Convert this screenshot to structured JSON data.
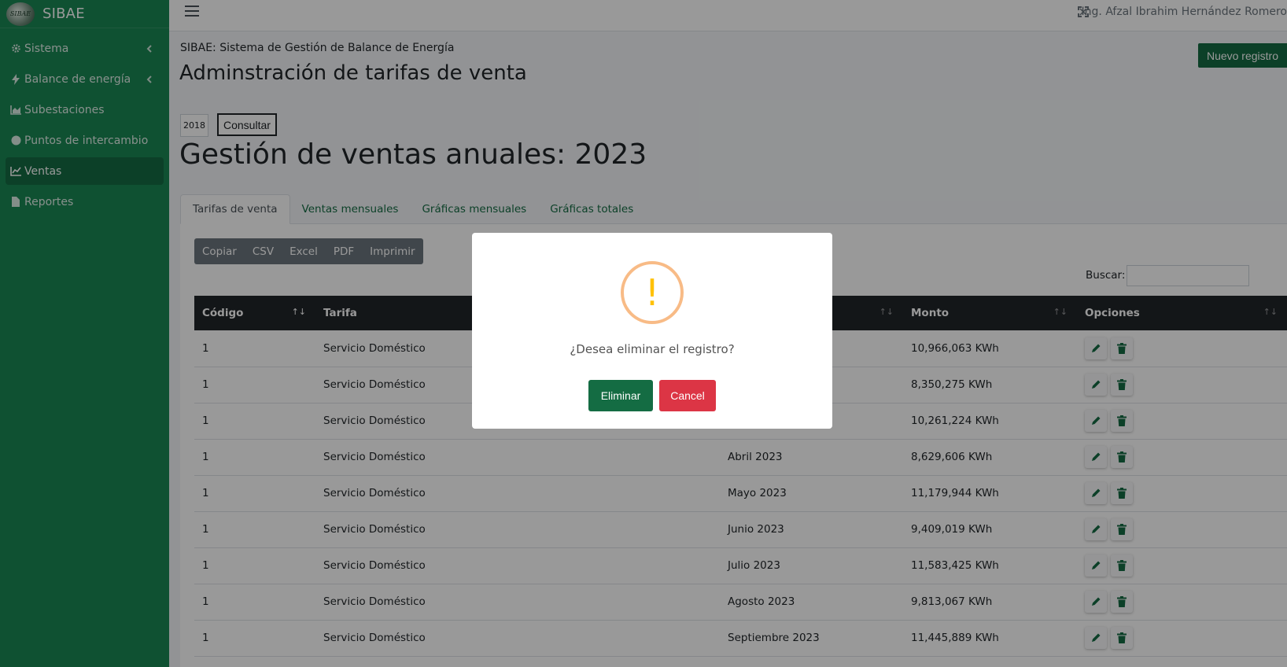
{
  "brand": {
    "name": "SIBAE",
    "logo_text": "SIBAE"
  },
  "sidebar": {
    "items": [
      {
        "label": "Sistema",
        "icon": "gear-icon",
        "has_caret": true
      },
      {
        "label": "Balance de energía",
        "icon": "bolt-icon",
        "has_caret": true
      },
      {
        "label": "Subestaciones",
        "icon": "chart-area-icon",
        "has_caret": false
      },
      {
        "label": "Puntos de intercambio",
        "icon": "circle-icon",
        "has_caret": false
      },
      {
        "label": "Ventas",
        "icon": "chart-line-icon",
        "has_caret": false,
        "active": true
      },
      {
        "label": "Reportes",
        "icon": "file-icon",
        "has_caret": false
      }
    ]
  },
  "header": {
    "user": "Ing. Afzal Ibrahim Hernández Romero"
  },
  "page": {
    "breadcrumb": "SIBAE: Sistema de Gestión de Balance de Energía",
    "title": "Adminstración de tarifas de venta",
    "new_button": "Nuevo registro",
    "year_value": "2018",
    "consult_button": "Consultar",
    "section_title": "Gestión de ventas anuales: 2023"
  },
  "tabs": [
    "Tarifas de venta",
    "Ventas mensuales",
    "Gráficas mensuales",
    "Gráficas totales"
  ],
  "toolbar": {
    "buttons": [
      "Copiar",
      "CSV",
      "Excel",
      "PDF",
      "Imprimir"
    ],
    "search_label": "Buscar:"
  },
  "table": {
    "columns": [
      "Código",
      "Tarifa",
      "",
      "Monto",
      "Opciones"
    ],
    "rows": [
      [
        "1",
        "Servicio Doméstico",
        "",
        "10,966,063 KWh"
      ],
      [
        "1",
        "Servicio Doméstico",
        "",
        "8,350,275 KWh"
      ],
      [
        "1",
        "Servicio Doméstico",
        "",
        "10,261,224 KWh"
      ],
      [
        "1",
        "Servicio Doméstico",
        "Abril 2023",
        "8,629,606 KWh"
      ],
      [
        "1",
        "Servicio Doméstico",
        "Mayo 2023",
        "11,179,944 KWh"
      ],
      [
        "1",
        "Servicio Doméstico",
        "Junio 2023",
        "9,409,019 KWh"
      ],
      [
        "1",
        "Servicio Doméstico",
        "Julio 2023",
        "11,583,425 KWh"
      ],
      [
        "1",
        "Servicio Doméstico",
        "Agosto 2023",
        "9,813,067 KWh"
      ],
      [
        "1",
        "Servicio Doméstico",
        "Septiembre 2023",
        "11,445,889 KWh"
      ]
    ]
  },
  "modal": {
    "icon": "!",
    "message": "¿Desea eliminar el registro?",
    "confirm": "Eliminar",
    "cancel": "Cancel"
  },
  "colors": {
    "sidebar": "#198754",
    "primary": "#146c43",
    "danger": "#dc3545",
    "warning": "#f8bb86"
  }
}
